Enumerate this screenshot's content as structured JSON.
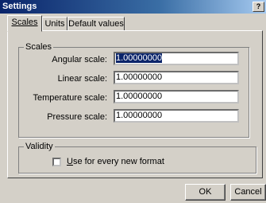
{
  "window": {
    "title": "Settings",
    "help_label": "?"
  },
  "tabs": [
    "Scales",
    "Units",
    "Default values"
  ],
  "scales_group": {
    "title": "Scales",
    "fields": [
      {
        "label": "Angular scale:",
        "value": "1.00000000"
      },
      {
        "label": "Linear scale:",
        "value": "1.00000000"
      },
      {
        "label": "Temperature scale:",
        "value": "1.00000000"
      },
      {
        "label": "Pressure scale:",
        "value": "1.00000000"
      }
    ]
  },
  "validity_group": {
    "title": "Validity",
    "checkbox_label_underlined": "U",
    "checkbox_label_rest": "se for every new format",
    "checked": false
  },
  "buttons": {
    "ok": "OK",
    "cancel": "Cancel"
  }
}
